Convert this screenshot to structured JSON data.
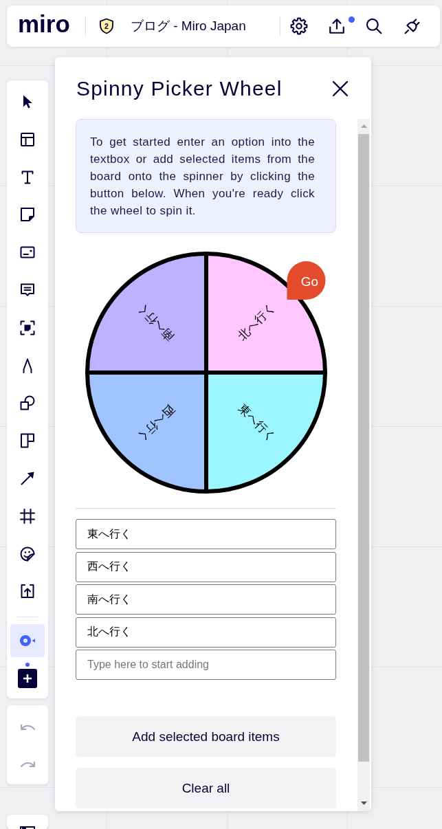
{
  "topbar": {
    "logo": "miro",
    "badge": "2",
    "board_title": "ブログ - Miro Japan",
    "actions": [
      {
        "notification": false
      },
      {
        "notification": true
      },
      {
        "notification": false
      },
      {
        "notification": false
      }
    ]
  },
  "toolbar": {
    "tools": [
      {
        "selected": false
      },
      {
        "selected": false
      },
      {
        "selected": false
      },
      {
        "selected": false
      },
      {
        "selected": false
      },
      {
        "selected": false
      },
      {
        "selected": false
      },
      {
        "selected": false
      },
      {
        "selected": false
      },
      {
        "selected": false
      },
      {
        "selected": false
      },
      {
        "selected": false
      },
      {
        "selected": false
      },
      {
        "selected": false
      }
    ],
    "apps": [
      {
        "selected": true
      }
    ],
    "add_apps": {
      "notification": true
    },
    "history": [
      {
        "disabled": true
      },
      {
        "disabled": true
      }
    ]
  },
  "panel": {
    "title": "Spinny Picker Wheel",
    "intro": "To get started enter an option into the textbox or add selected items from the board onto the spinner by clicking the button below. When you're ready click the wheel to spin it.",
    "wheel": {
      "segments": [
        {
          "label": "東へ行く",
          "color": "#9bf6ff"
        },
        {
          "label": "西へ行く",
          "color": "#a0c4ff"
        },
        {
          "label": "南へ行く",
          "color": "#bdb2ff"
        },
        {
          "label": "北へ行く",
          "color": "#ffc6ff"
        }
      ],
      "pointer": "Go"
    },
    "options": [
      "東へ行く",
      "西へ行く",
      "南へ行く",
      "北へ行く"
    ],
    "new_option": {
      "placeholder": "Type here to start adding"
    },
    "buttons": [
      "Add selected board items",
      "Clear all"
    ]
  }
}
